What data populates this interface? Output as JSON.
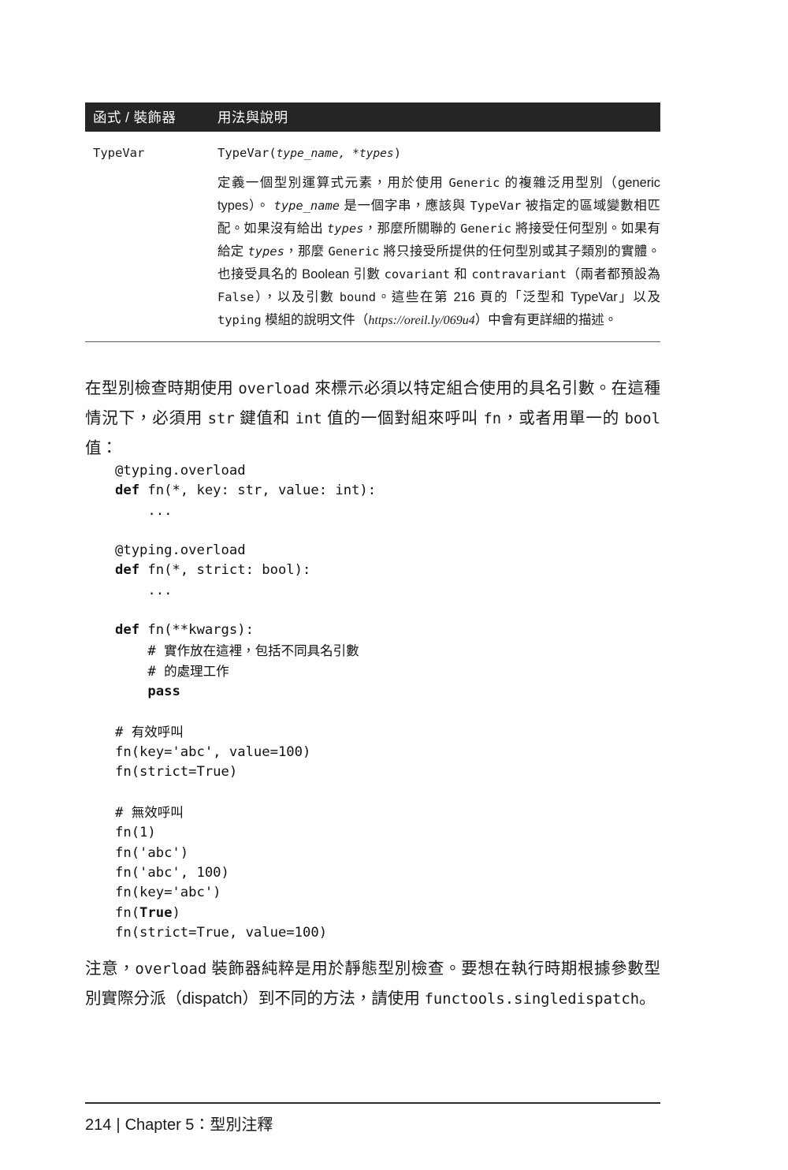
{
  "page": {
    "number": "214",
    "chapter_label": "Chapter 5",
    "chapter_separator": "：",
    "chapter_title": "型別注釋",
    "footer_separator": "|"
  },
  "table": {
    "headers": {
      "col1": "函式 / 裝飾器",
      "col2": "用法與說明"
    },
    "rows": [
      {
        "name": "TypeVar",
        "signature_prefix": "TypeVar(",
        "signature_arg1": "type_name, *types",
        "signature_suffix": ")",
        "description_segments": [
          {
            "text": "定義一個型別運算式元素，用於使用 ",
            "style": "plain"
          },
          {
            "text": "Generic",
            "style": "mono"
          },
          {
            "text": " 的複雜泛用型別（generic types）。 ",
            "style": "plain"
          },
          {
            "text": "type_name",
            "style": "mono-italic"
          },
          {
            "text": " 是一個字串，應該與 ",
            "style": "plain"
          },
          {
            "text": "TypeVar",
            "style": "mono"
          },
          {
            "text": " 被指定的區域變數相匹配。如果沒有給出 ",
            "style": "plain"
          },
          {
            "text": "types",
            "style": "mono-italic"
          },
          {
            "text": "，那麼所關聯的 ",
            "style": "plain"
          },
          {
            "text": "Generic",
            "style": "mono"
          },
          {
            "text": " 將接受任何型別。如果有給定 ",
            "style": "plain"
          },
          {
            "text": "types",
            "style": "mono-italic"
          },
          {
            "text": "，那麼 ",
            "style": "plain"
          },
          {
            "text": "Generic",
            "style": "mono"
          },
          {
            "text": " 將只接受所提供的任何型別或其子類別的實體。也接受具名的 Boolean 引數 ",
            "style": "plain"
          },
          {
            "text": "covariant",
            "style": "mono"
          },
          {
            "text": " 和 ",
            "style": "plain"
          },
          {
            "text": "contravariant",
            "style": "mono"
          },
          {
            "text": "（兩者都預設為 ",
            "style": "plain"
          },
          {
            "text": "False",
            "style": "mono"
          },
          {
            "text": "），以及引數 ",
            "style": "plain"
          },
          {
            "text": "bound",
            "style": "mono"
          },
          {
            "text": "。這些在第 216 頁的「泛型和 TypeVar」以及 ",
            "style": "plain"
          },
          {
            "text": "typing",
            "style": "mono"
          },
          {
            "text": " 模組的說明文件（",
            "style": "plain"
          },
          {
            "text": "https://oreil.ly/069u4",
            "style": "serif-italic"
          },
          {
            "text": "）中會有更詳細的描述。",
            "style": "plain"
          }
        ]
      }
    ]
  },
  "paragraphs": [
    {
      "id": "para-1",
      "segments": [
        {
          "text": "在型別檢查時期使用 ",
          "style": "plain"
        },
        {
          "text": "overload",
          "style": "mono"
        },
        {
          "text": " 來標示必須以特定組合使用的具名引數。在這種情況下，必須用 ",
          "style": "plain"
        },
        {
          "text": "str",
          "style": "mono"
        },
        {
          "text": " 鍵值和 ",
          "style": "plain"
        },
        {
          "text": "int",
          "style": "mono"
        },
        {
          "text": " 值的一個對組來呼叫 ",
          "style": "plain"
        },
        {
          "text": "fn",
          "style": "mono"
        },
        {
          "text": "，或者用單一的 ",
          "style": "plain"
        },
        {
          "text": "bool",
          "style": "mono"
        },
        {
          "text": " 值：",
          "style": "plain"
        }
      ]
    },
    {
      "id": "para-2",
      "segments": [
        {
          "text": "注意，",
          "style": "plain"
        },
        {
          "text": "overload",
          "style": "mono"
        },
        {
          "text": " 裝飾器純粹是用於靜態型別檢查。要想在執行時期根據參數型別實際分派（dispatch）到不同的方法，請使用 ",
          "style": "plain"
        },
        {
          "text": "functools.singledispatch",
          "style": "mono"
        },
        {
          "text": "。",
          "style": "plain"
        }
      ]
    }
  ],
  "code_block": {
    "lines": [
      [
        {
          "text": "@typing.overload",
          "style": "plain"
        }
      ],
      [
        {
          "text": "def",
          "style": "bold"
        },
        {
          "text": " fn(*, key: str, value: int):",
          "style": "plain"
        }
      ],
      [
        {
          "text": "    ...",
          "style": "plain"
        }
      ],
      [
        {
          "text": "",
          "style": "plain"
        }
      ],
      [
        {
          "text": "@typing.overload",
          "style": "plain"
        }
      ],
      [
        {
          "text": "def",
          "style": "bold"
        },
        {
          "text": " fn(*, strict: bool):",
          "style": "plain"
        }
      ],
      [
        {
          "text": "    ...",
          "style": "plain"
        }
      ],
      [
        {
          "text": "",
          "style": "plain"
        }
      ],
      [
        {
          "text": "def",
          "style": "bold"
        },
        {
          "text": " fn(**kwargs):",
          "style": "plain"
        }
      ],
      [
        {
          "text": "    # ",
          "style": "plain"
        },
        {
          "text": "實作放在這裡，包括不同具名引數",
          "style": "cjk-comment"
        }
      ],
      [
        {
          "text": "    # ",
          "style": "plain"
        },
        {
          "text": "的處理工作",
          "style": "cjk-comment"
        }
      ],
      [
        {
          "text": "    ",
          "style": "plain"
        },
        {
          "text": "pass",
          "style": "bold"
        }
      ],
      [
        {
          "text": "",
          "style": "plain"
        }
      ],
      [
        {
          "text": "# ",
          "style": "plain"
        },
        {
          "text": "有效呼叫",
          "style": "cjk-comment"
        }
      ],
      [
        {
          "text": "fn(key='abc', value=100)",
          "style": "plain"
        }
      ],
      [
        {
          "text": "fn(strict=True)",
          "style": "plain"
        }
      ],
      [
        {
          "text": "",
          "style": "plain"
        }
      ],
      [
        {
          "text": "# ",
          "style": "plain"
        },
        {
          "text": "無效呼叫",
          "style": "cjk-comment"
        }
      ],
      [
        {
          "text": "fn(1)",
          "style": "plain"
        }
      ],
      [
        {
          "text": "fn('abc')",
          "style": "plain"
        }
      ],
      [
        {
          "text": "fn('abc', 100)",
          "style": "plain"
        }
      ],
      [
        {
          "text": "fn(key='abc')",
          "style": "plain"
        }
      ],
      [
        {
          "text": "fn(",
          "style": "plain"
        },
        {
          "text": "True",
          "style": "bold"
        },
        {
          "text": ")",
          "style": "plain"
        }
      ],
      [
        {
          "text": "fn(strict=True, value=100)",
          "style": "plain"
        }
      ]
    ]
  },
  "colors": {
    "table_header_background": "#252526",
    "table_header_text": "#ffffff",
    "page_background": "#ffffff",
    "body_text": "#1a1a1a",
    "rule": "#5a5a5a"
  }
}
